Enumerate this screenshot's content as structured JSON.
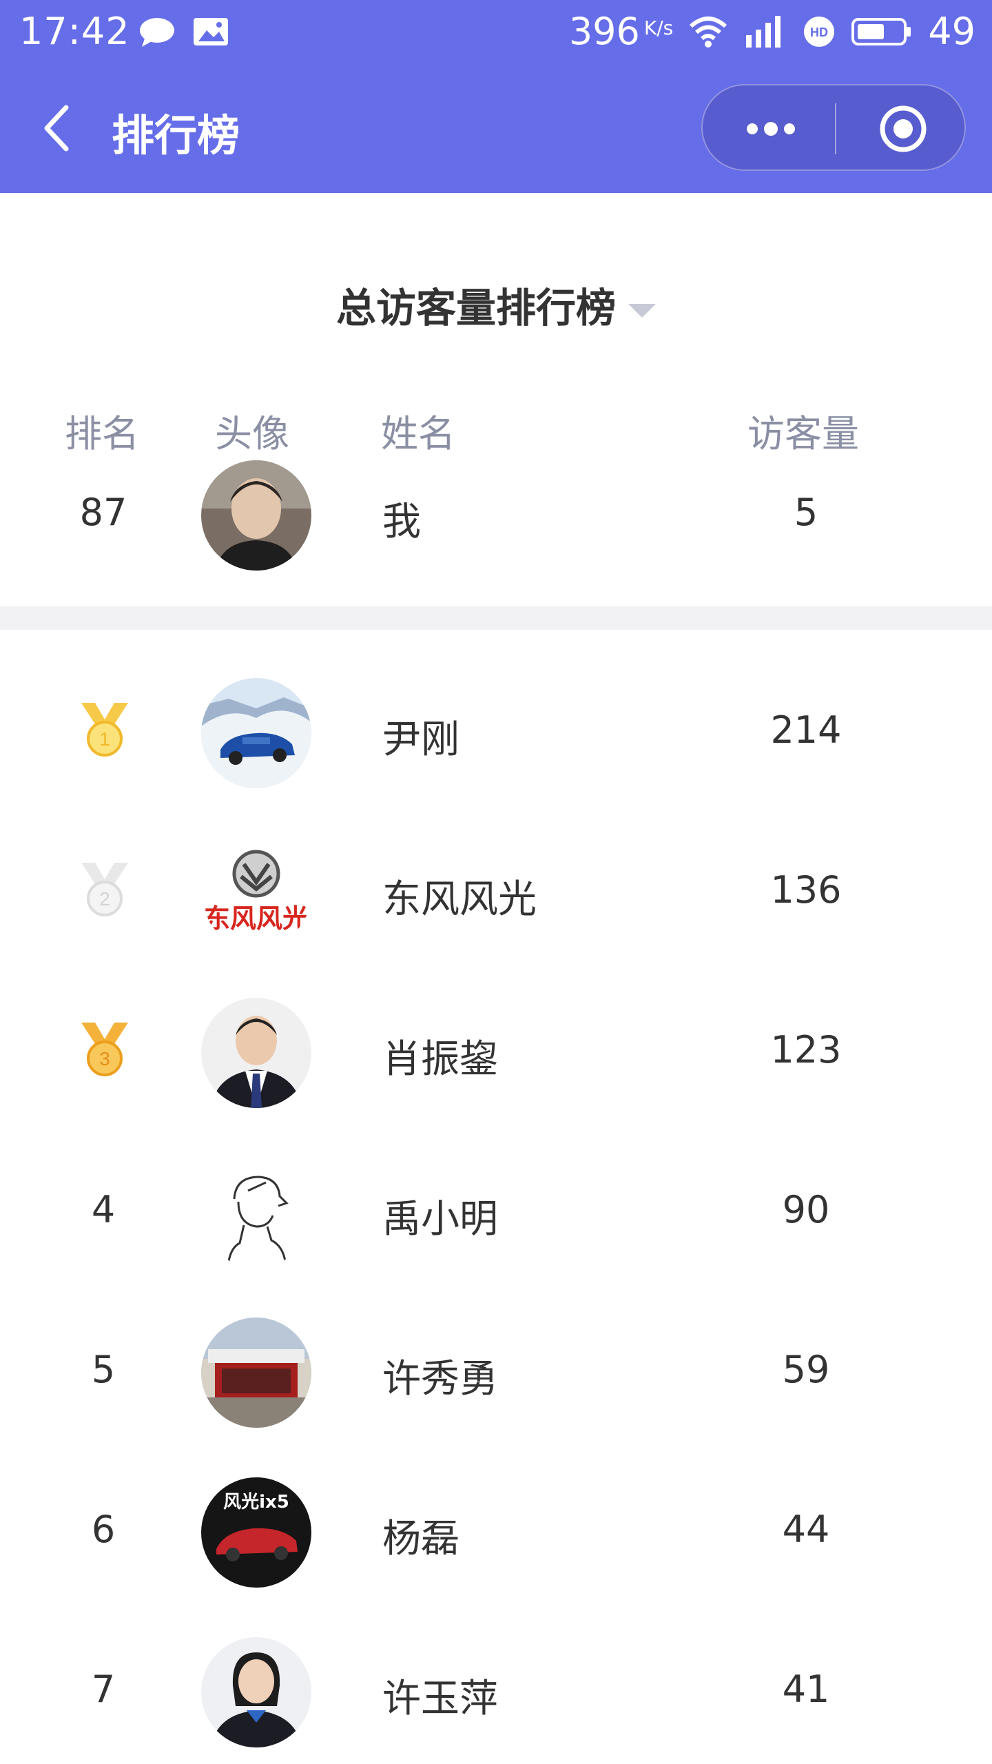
{
  "status_bar": {
    "time": "17:42",
    "speed": "396",
    "speed_unit": "K/s",
    "battery": "49"
  },
  "nav": {
    "title": "排行榜"
  },
  "board": {
    "title": "总访客量排行榜"
  },
  "columns": {
    "rank": "排名",
    "avatar": "头像",
    "name": "姓名",
    "visits": "访客量"
  },
  "me": {
    "rank": "87",
    "name": "我",
    "visits": "5"
  },
  "rows": [
    {
      "rank": "1",
      "name": "尹刚",
      "visits": "214",
      "medal": "gold"
    },
    {
      "rank": "2",
      "name": "东风风光",
      "visits": "136",
      "medal": "silver",
      "logo_text": "东风风光"
    },
    {
      "rank": "3",
      "name": "肖振鋆",
      "visits": "123",
      "medal": "bronze"
    },
    {
      "rank": "4",
      "name": "禹小明",
      "visits": "90"
    },
    {
      "rank": "5",
      "name": "许秀勇",
      "visits": "59"
    },
    {
      "rank": "6",
      "name": "杨磊",
      "visits": "44",
      "logo_text": "风光ix5"
    },
    {
      "rank": "7",
      "name": "许玉萍",
      "visits": "41"
    }
  ]
}
